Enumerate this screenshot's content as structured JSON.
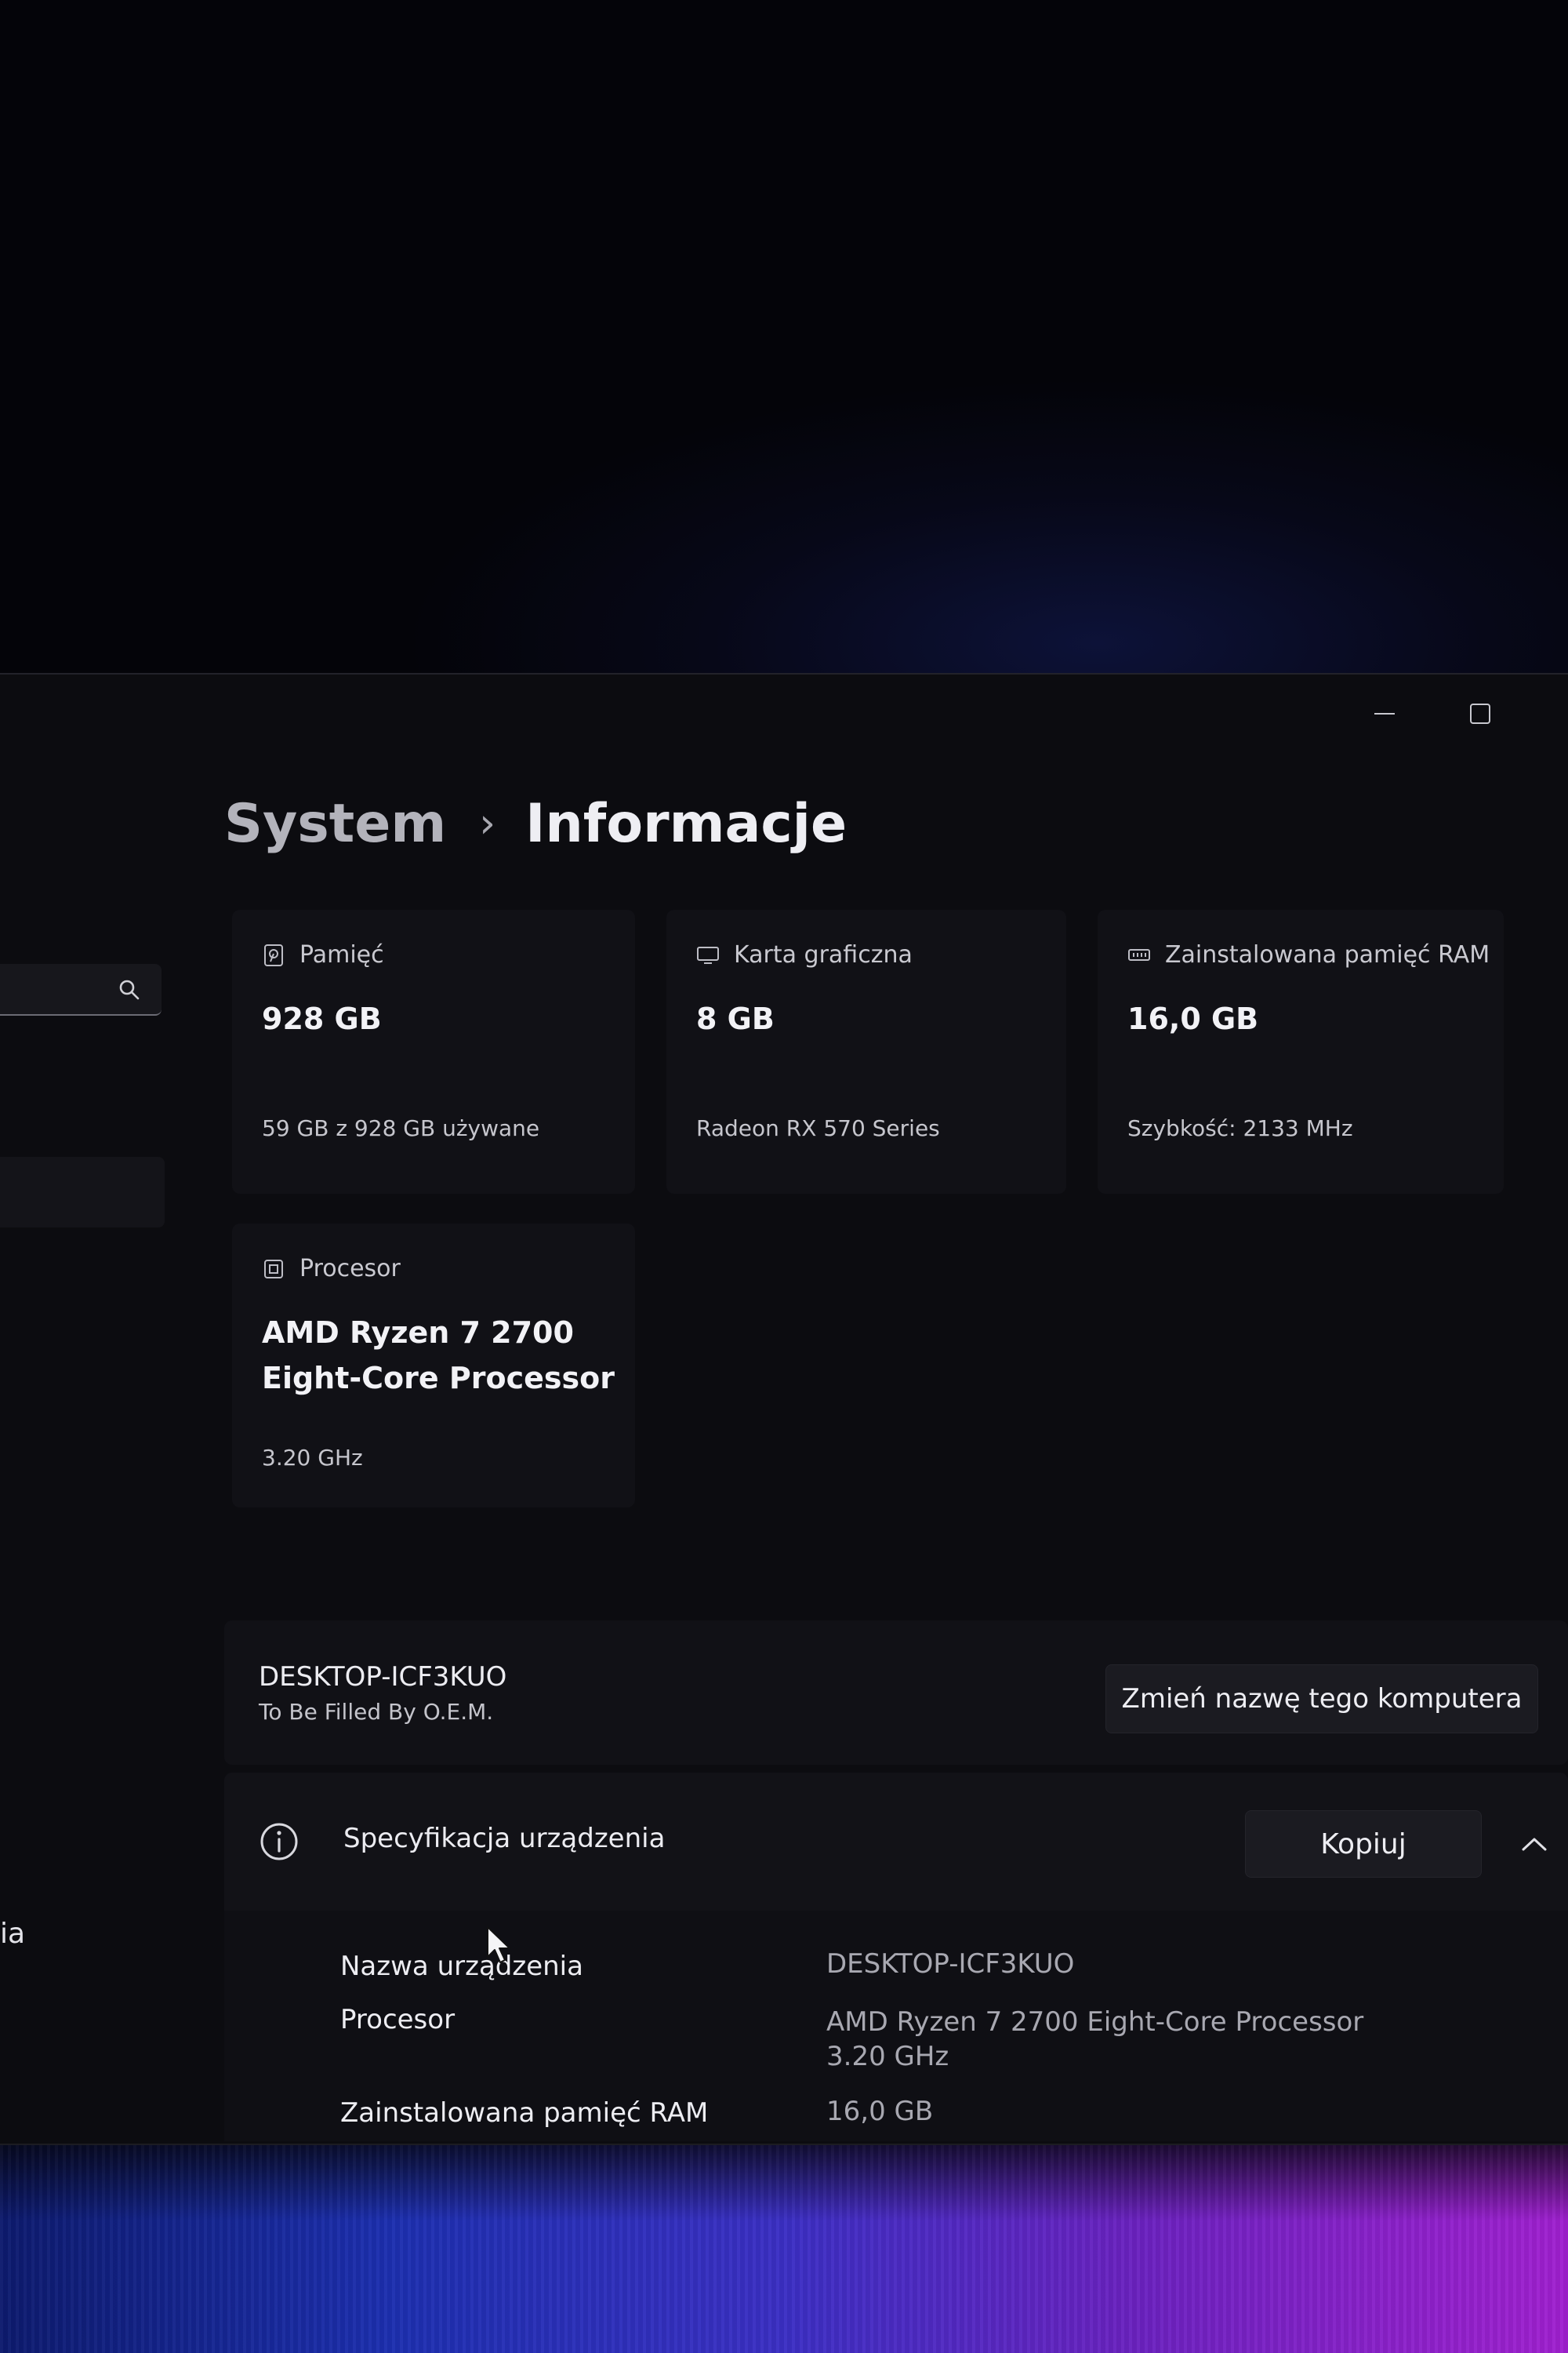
{
  "window": {
    "controls": {
      "minimize": "minimize-icon",
      "maximize": "maximize-icon"
    }
  },
  "sidebar": {
    "search": {
      "icon": "search-icon"
    },
    "items": [
      {
        "label": "ia"
      }
    ]
  },
  "breadcrumb": {
    "parent": "System",
    "separator": "›",
    "current": "Informacje"
  },
  "cards": {
    "storage": {
      "title": "Pamięć",
      "value": "928 GB",
      "detail": "59 GB z 928 GB używane",
      "icon": "storage-icon"
    },
    "gpu": {
      "title": "Karta graficzna",
      "value": "8 GB",
      "detail": "Radeon RX 570 Series",
      "icon": "display-icon"
    },
    "ram": {
      "title": "Zainstalowana pamięć RAM",
      "value": "16,0 GB",
      "detail": "Szybkość: 2133 MHz",
      "icon": "memory-icon"
    },
    "cpu": {
      "title": "Procesor",
      "value_line1": "AMD Ryzen 7 2700",
      "value_line2": "Eight-Core Processor",
      "detail": "3.20 GHz",
      "icon": "processor-icon"
    }
  },
  "device": {
    "name": "DESKTOP-ICF3KUO",
    "model": "To Be Filled By O.E.M.",
    "rename_label": "Zmień nazwę tego komputera"
  },
  "specs": {
    "title": "Specyfikacja urządzenia",
    "copy_label": "Kopiuj",
    "icon": "info-icon",
    "collapse_icon": "chevron-up-icon",
    "rows": [
      {
        "label": "Nazwa urządzenia",
        "value": "DESKTOP-ICF3KUO"
      },
      {
        "label": "Procesor",
        "value": "AMD Ryzen 7 2700 Eight-Core Processor",
        "value_line2": "3.20 GHz"
      },
      {
        "label": "Zainstalowana pamięć RAM",
        "value": "16,0 GB"
      }
    ]
  }
}
